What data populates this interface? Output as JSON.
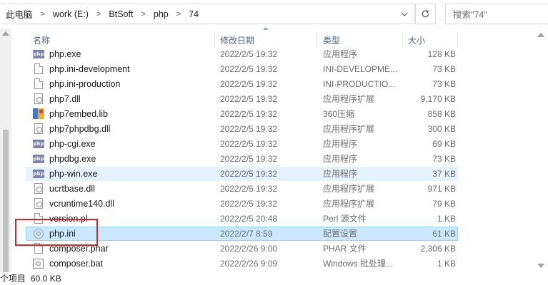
{
  "breadcrumb": [
    "此电脑",
    "work (E:)",
    "BtSoft",
    "php",
    "74"
  ],
  "search": {
    "placeholder": "搜索\"74\""
  },
  "columns": {
    "name": "名称",
    "date": "修改日期",
    "type": "类型",
    "size": "大小"
  },
  "files": [
    {
      "name": "php.exe",
      "date": "2022/2/5 19:32",
      "type": "应用程序",
      "size": "128 KB",
      "icon": "php-exe-icon"
    },
    {
      "name": "php.ini-development",
      "date": "2022/2/5 19:32",
      "type": "INI-DEVELOPME...",
      "size": "73 KB",
      "icon": "file-icon"
    },
    {
      "name": "php.ini-production",
      "date": "2022/2/5 19:32",
      "type": "INI-PRODUCTIO...",
      "size": "73 KB",
      "icon": "file-icon"
    },
    {
      "name": "php7.dll",
      "date": "2022/2/5 19:32",
      "type": "应用程序扩展",
      "size": "9,170 KB",
      "icon": "dll-icon"
    },
    {
      "name": "php7embed.lib",
      "date": "2022/2/5 19:32",
      "type": "360压缩",
      "size": "858 KB",
      "icon": "archive-icon"
    },
    {
      "name": "php7phpdbg.dll",
      "date": "2022/2/5 19:32",
      "type": "应用程序扩展",
      "size": "300 KB",
      "icon": "dll-icon"
    },
    {
      "name": "php-cgi.exe",
      "date": "2022/2/5 19:32",
      "type": "应用程序",
      "size": "69 KB",
      "icon": "php-exe-icon"
    },
    {
      "name": "phpdbg.exe",
      "date": "2022/2/5 19:32",
      "type": "应用程序",
      "size": "73 KB",
      "icon": "php-exe-icon"
    },
    {
      "name": "php-win.exe",
      "date": "2022/2/5 19:32",
      "type": "应用程序",
      "size": "37 KB",
      "icon": "php-exe-icon"
    },
    {
      "name": "ucrtbase.dll",
      "date": "2022/2/5 19:32",
      "type": "应用程序扩展",
      "size": "971 KB",
      "icon": "dll-icon"
    },
    {
      "name": "vcruntime140.dll",
      "date": "2022/2/5 19:32",
      "type": "应用程序扩展",
      "size": "79 KB",
      "icon": "dll-icon"
    },
    {
      "name": "version.pl",
      "date": "2022/2/5 20:48",
      "type": "Perl 源文件",
      "size": "1 KB",
      "icon": "file-icon"
    },
    {
      "name": "php.ini",
      "date": "2022/2/7 8:59",
      "type": "配置设置",
      "size": "61 KB",
      "icon": "config-icon"
    },
    {
      "name": "composer.phar",
      "date": "2022/2/26 9:00",
      "type": "PHAR 文件",
      "size": "2,306 KB",
      "icon": "file-icon"
    },
    {
      "name": "composer.bat",
      "date": "2022/2/26 9:09",
      "type": "Windows 批处理...",
      "size": "1 KB",
      "icon": "batch-icon"
    }
  ],
  "hover_row": "php-win.exe",
  "selected_row": "php.ini",
  "annotation_color": "#e02424",
  "status": {
    "item_count": "个项目",
    "size": "60.0 KB"
  }
}
